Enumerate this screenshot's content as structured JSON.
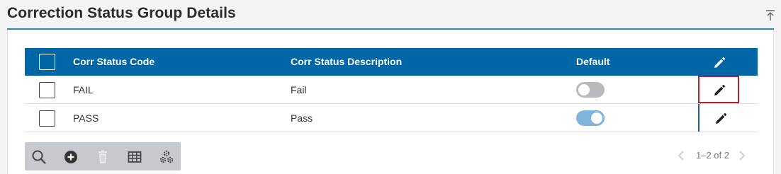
{
  "panel": {
    "title": "Correction Status Group Details"
  },
  "grid": {
    "columns": [
      "Corr Status Code",
      "Corr Status Description",
      "Default"
    ],
    "rows": [
      {
        "code": "FAIL",
        "description": "Fail",
        "default": false
      },
      {
        "code": "PASS",
        "description": "Pass",
        "default": true
      }
    ]
  },
  "toolbar": {
    "buttons": [
      "search-icon",
      "add-circle-icon",
      "trash-icon",
      "table-columns-icon",
      "settings-gears-icon"
    ]
  },
  "pager": {
    "range": "1–2 of 2"
  },
  "colors": {
    "header_bg": "#0066a6",
    "accent_rule": "#2f86c3",
    "toggle_on": "#7fb4dd",
    "toggle_off": "#b9b9bd",
    "focus_border": "#b0242c",
    "toolbar_bg": "#c6c9ce"
  }
}
